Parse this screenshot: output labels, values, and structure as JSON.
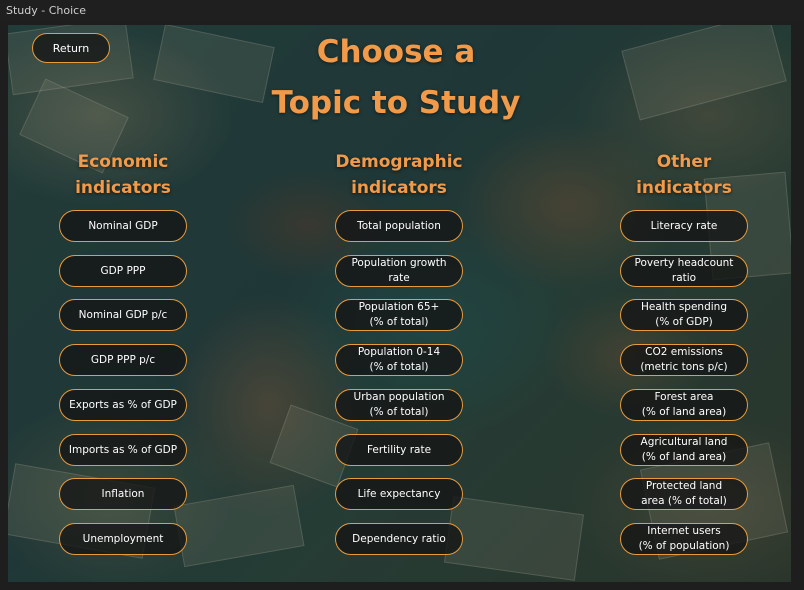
{
  "window": {
    "title": "Study - Choice"
  },
  "return_label": "Return",
  "heading": {
    "line1": "Choose a",
    "line2": "Topic to Study"
  },
  "columns": [
    {
      "header": [
        "Economic",
        "indicators"
      ],
      "items": [
        [
          "Nominal GDP"
        ],
        [
          "GDP PPP"
        ],
        [
          "Nominal GDP p/c"
        ],
        [
          "GDP PPP p/c"
        ],
        [
          "Exports as % of GDP"
        ],
        [
          "Imports as % of GDP"
        ],
        [
          "Inflation"
        ],
        [
          "Unemployment"
        ]
      ]
    },
    {
      "header": [
        "Demographic",
        "indicators"
      ],
      "items": [
        [
          "Total population"
        ],
        [
          "Population growth",
          "rate"
        ],
        [
          "Population 65+",
          "(% of total)"
        ],
        [
          "Population 0-14",
          "(% of total)"
        ],
        [
          "Urban population",
          "(% of total)"
        ],
        [
          "Fertility rate"
        ],
        [
          "Life expectancy"
        ],
        [
          "Dependency ratio"
        ]
      ]
    },
    {
      "header": [
        "Other",
        "indicators"
      ],
      "items": [
        [
          "Literacy rate"
        ],
        [
          "Poverty headcount",
          "ratio"
        ],
        [
          "Health spending",
          "(% of GDP)"
        ],
        [
          "CO2 emissions",
          "(metric tons p/c)"
        ],
        [
          "Forest area",
          "(% of land area)"
        ],
        [
          "Agricultural land",
          "(% of land area)"
        ],
        [
          "Protected land",
          "area (% of total)"
        ],
        [
          "Internet users",
          "(% of population)"
        ]
      ]
    }
  ],
  "colors": {
    "accent": "#e89a3c",
    "title": "#f19a4a",
    "pill_bg": "#141414"
  }
}
